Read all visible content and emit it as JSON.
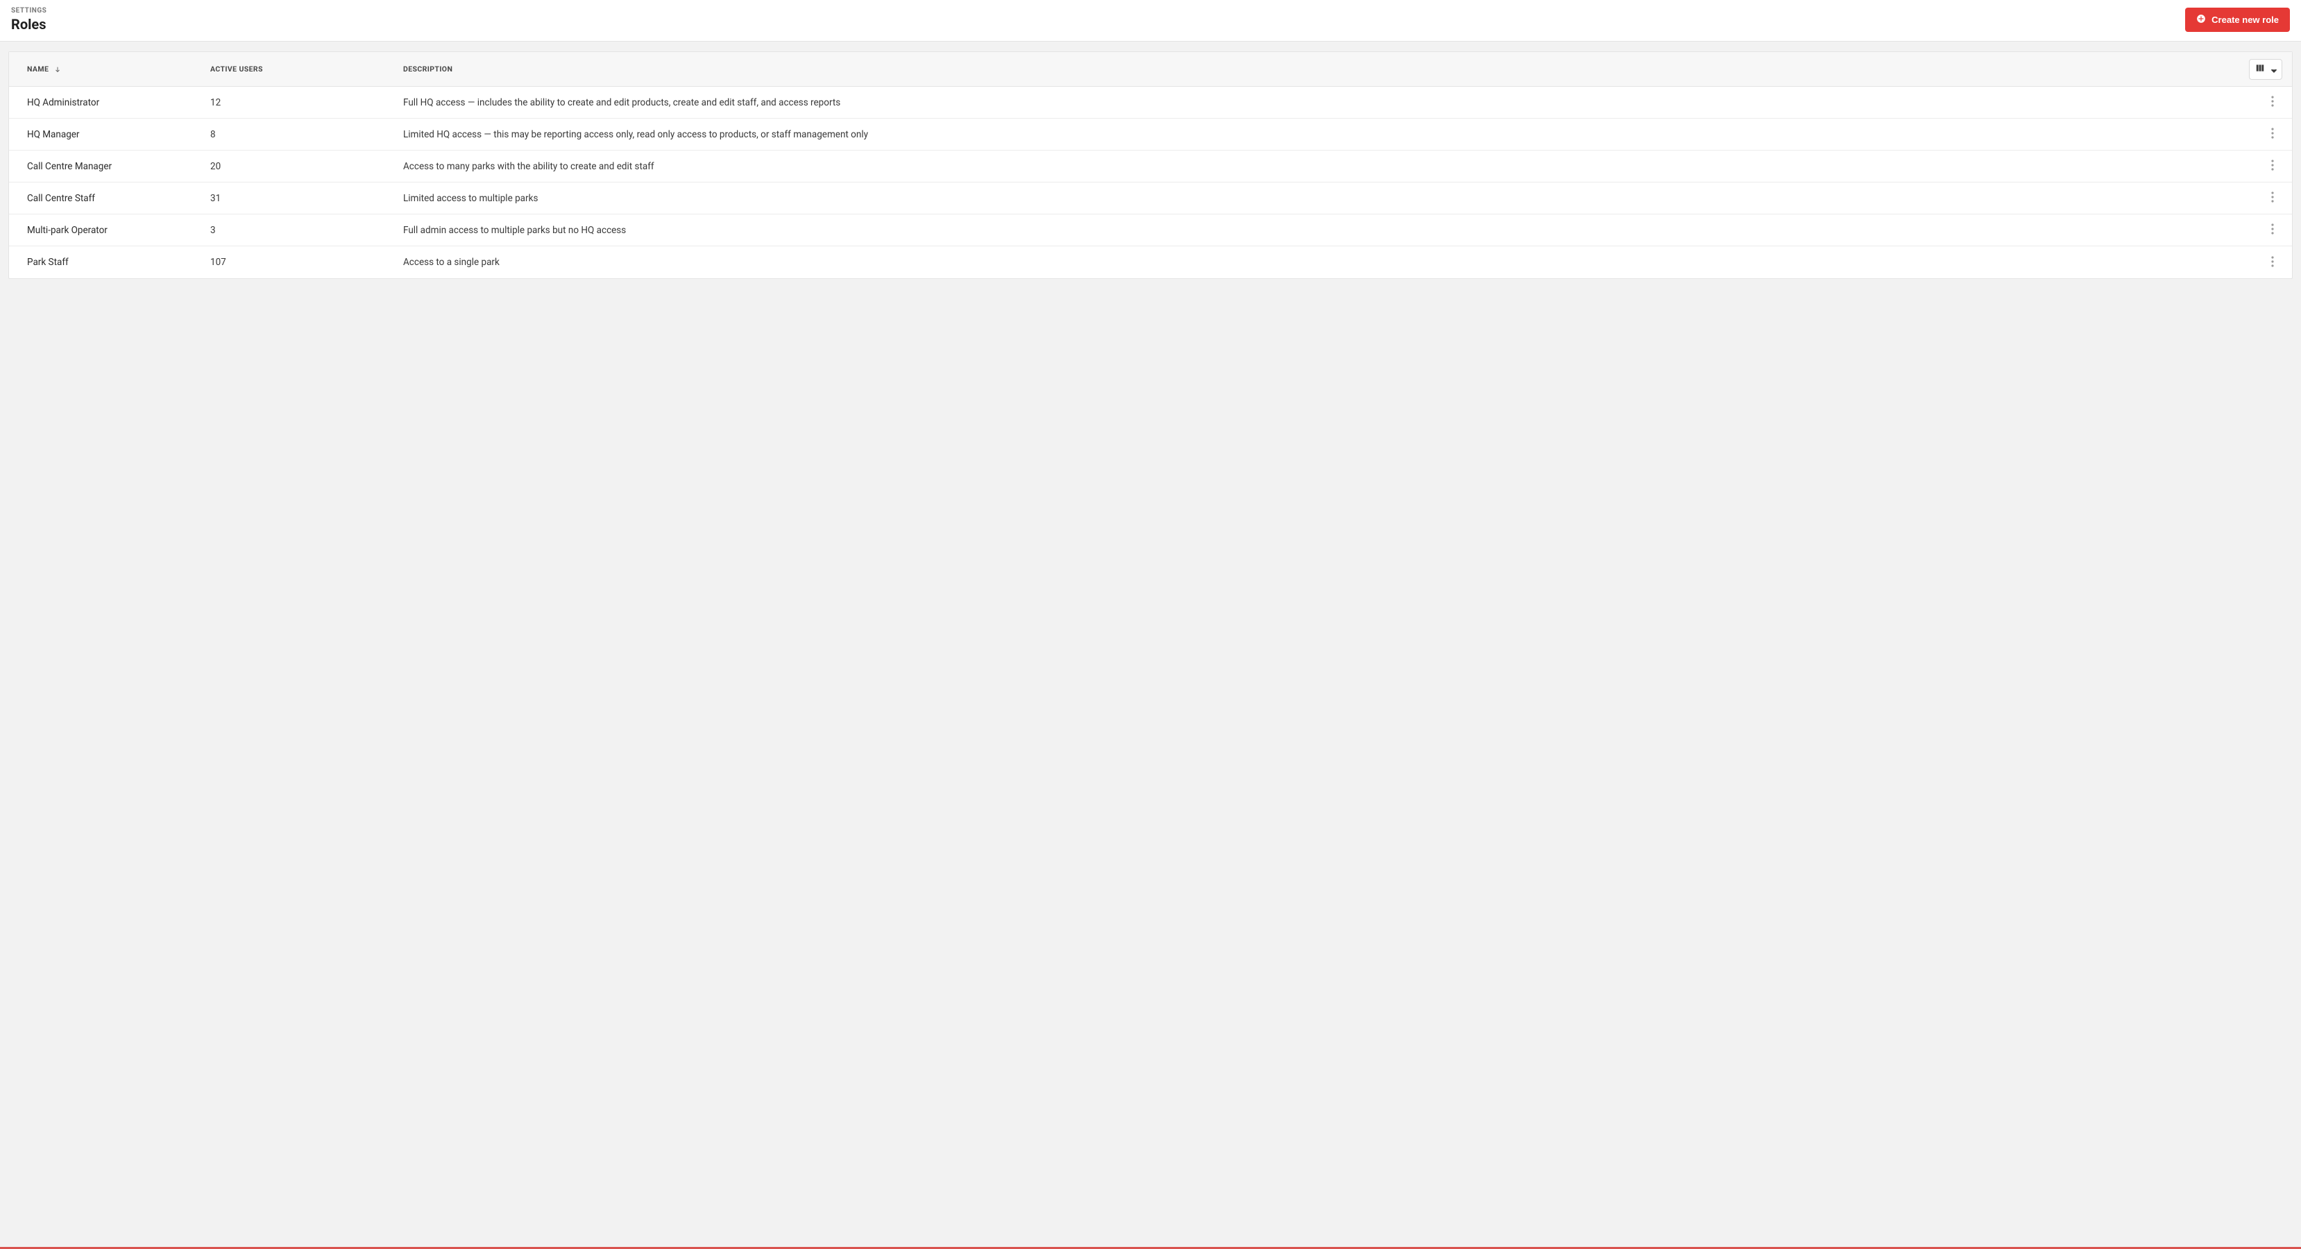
{
  "header": {
    "breadcrumb": "SETTINGS",
    "title": "Roles",
    "create_button_label": "Create new role"
  },
  "table": {
    "columns": {
      "name": "NAME",
      "active_users": "ACTIVE USERS",
      "description": "DESCRIPTION"
    },
    "sort": {
      "column": "name",
      "direction": "asc"
    },
    "rows": [
      {
        "name": "HQ Administrator",
        "active_users": "12",
        "description": "Full HQ access — includes the ability to create and edit products, create and edit staff, and access reports"
      },
      {
        "name": "HQ Manager",
        "active_users": "8",
        "description": "Limited HQ access — this may be reporting access only, read only access to products, or staff management only"
      },
      {
        "name": "Call Centre Manager",
        "active_users": "20",
        "description": "Access to many parks with the ability to create and edit staff"
      },
      {
        "name": "Call Centre Staff",
        "active_users": "31",
        "description": "Limited access to multiple parks"
      },
      {
        "name": "Multi-park Operator",
        "active_users": "3",
        "description": "Full admin access to multiple parks but no HQ access"
      },
      {
        "name": "Park Staff",
        "active_users": "107",
        "description": "Access to a single park"
      }
    ]
  },
  "colors": {
    "primary": "#e53935"
  }
}
